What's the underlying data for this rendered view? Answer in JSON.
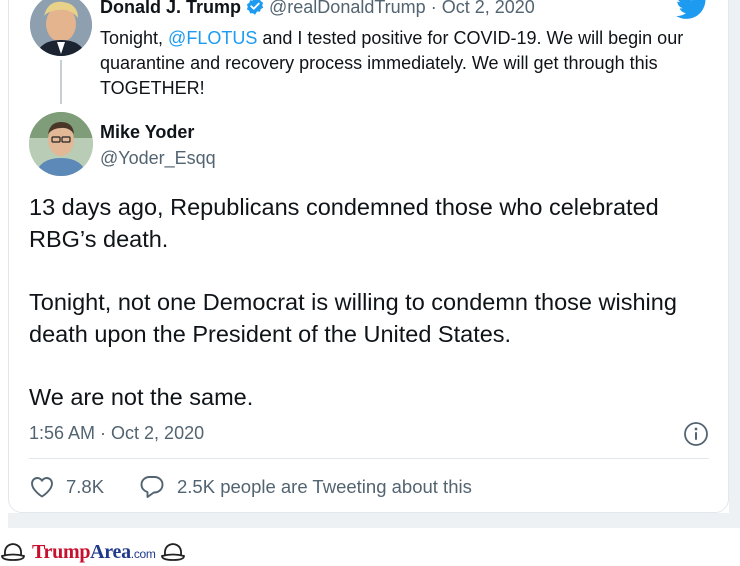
{
  "quoted_tweet": {
    "author_name": "Donald J. Trump",
    "handle": "@realDonaldTrump",
    "separator": " · ",
    "date": "Oct 2, 2020",
    "text_before_mention": "Tonight, ",
    "mention": "@FLOTUS",
    "text_after_mention": " and I tested positive for COVID-19. We will begin our quarantine and recovery process immediately. We will get through this TOGETHER!",
    "verified": true
  },
  "tweet": {
    "author_name": "Mike Yoder",
    "handle": "@Yoder_Esqq",
    "paragraphs": [
      "13 days ago, Republicans condemned those who celebrated RBG’s death.",
      "Tonight, not one Democrat is willing to condemn those wishing death upon the President of the United States.",
      "We are not the same."
    ],
    "timestamp": "1:56 AM · Oct 2, 2020",
    "likes": "7.8K",
    "conversation": "2.5K people are Tweeting about this"
  },
  "icons": [
    "twitter-bird-icon",
    "verified-badge-icon",
    "info-icon",
    "heart-icon",
    "reply-bubble-icon"
  ],
  "colors": {
    "accent": "#1d9bf0",
    "text": "#0f1419",
    "muted": "#536471"
  },
  "watermark": {
    "trump": "Trump",
    "area": "Area",
    "com": ".com"
  }
}
